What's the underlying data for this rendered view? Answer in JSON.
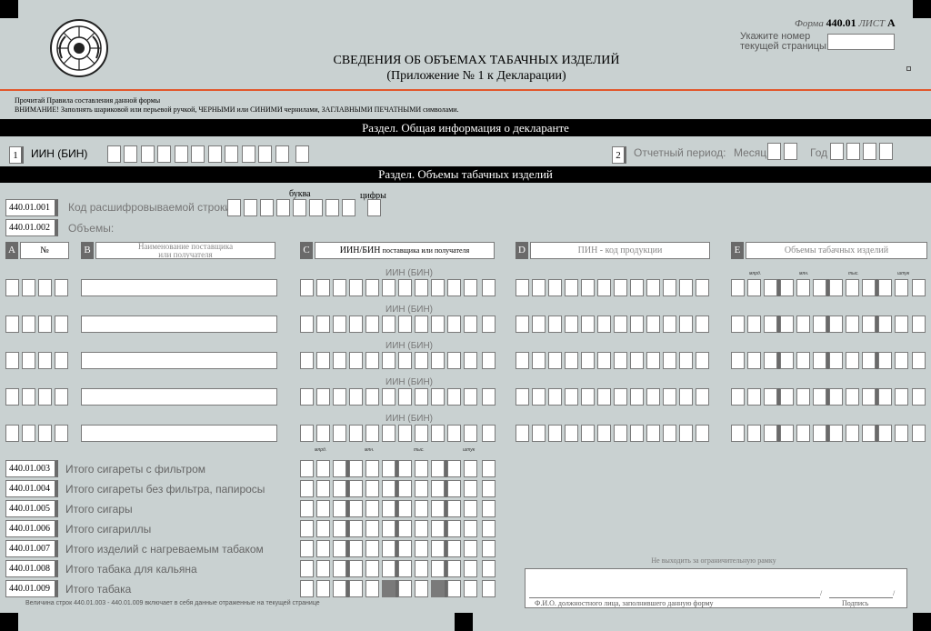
{
  "header": {
    "form_prefix": "Форма",
    "form_number": "440.01",
    "sheet_word": "ЛИСТ",
    "sheet_letter": "А",
    "page_prompt_1": "Укажите номер",
    "page_prompt_2": "текущей страницы:",
    "title": "СВЕДЕНИЯ ОБ ОБЪЕМАХ ТАБАЧНЫХ ИЗДЕЛИЙ",
    "subtitle": "(Приложение № 1 к Декларации)"
  },
  "instructions": {
    "line1": "Прочитай Правила составления данной формы",
    "line2": "ВНИМАНИЕ! Заполнять шариковой или перьевой ручкой, ЧЕРНЫМИ или СИНИМИ чернилами, ЗАГЛАВНЫМИ ПЕЧАТНЫМИ символами."
  },
  "section_general": {
    "title": "Раздел. Общая информация о декларанте",
    "f1_number": "1",
    "f1_label": "ИИН (БИН)",
    "f2_number": "2",
    "f2_label": "Отчетный период:",
    "month_label": "Месяц",
    "year_label": "Год"
  },
  "section_volumes": {
    "title": "Раздел. Объемы табачных изделий",
    "letter_label": "буква",
    "digits_label": "цифры",
    "row_code_id": "440.01.001",
    "row_code_label": "Код расшифровываемой строки",
    "volumes_id": "440.01.002",
    "volumes_label": "Объемы:",
    "columns": [
      {
        "letter": "A",
        "label": "№"
      },
      {
        "letter": "B",
        "label": "Наименование поставщика или получателя"
      },
      {
        "letter": "C",
        "label": "ИИН/БИН",
        "sub": "поставщика или получателя"
      },
      {
        "letter": "D",
        "label": "ПИН - код продукции"
      },
      {
        "letter": "E",
        "label": "Объемы табачных изделий"
      }
    ],
    "iin_row_label": "ИИН (БИН)",
    "units": [
      "млрд.",
      "млн.",
      "тыс.",
      "штук"
    ]
  },
  "totals": [
    {
      "code": "440.01.003",
      "label": "Итого сигареты с фильтром"
    },
    {
      "code": "440.01.004",
      "label": "Итого сигареты без фильтра, папиросы"
    },
    {
      "code": "440.01.005",
      "label": "Итого сигары"
    },
    {
      "code": "440.01.006",
      "label": "Итого сигариллы"
    },
    {
      "code": "440.01.007",
      "label": "Итого изделий с нагреваемым табаком"
    },
    {
      "code": "440.01.008",
      "label": "Итого табака для кальяна"
    },
    {
      "code": "440.01.009",
      "label": "Итого табака"
    }
  ],
  "footer": {
    "note": "Величина строк 440.01.003 - 440.01.009 включает в себя данные отраженные на текущей странице",
    "frame_note": "Не выходить за ограничительную рамку",
    "fio_label": "Ф.И.О. должностного лица, заполнившего данную форму",
    "sign_label": "Подпись"
  },
  "colors": {
    "background": "#c9d1d1",
    "accent_line": "#e2572b",
    "bars": "#000000"
  }
}
